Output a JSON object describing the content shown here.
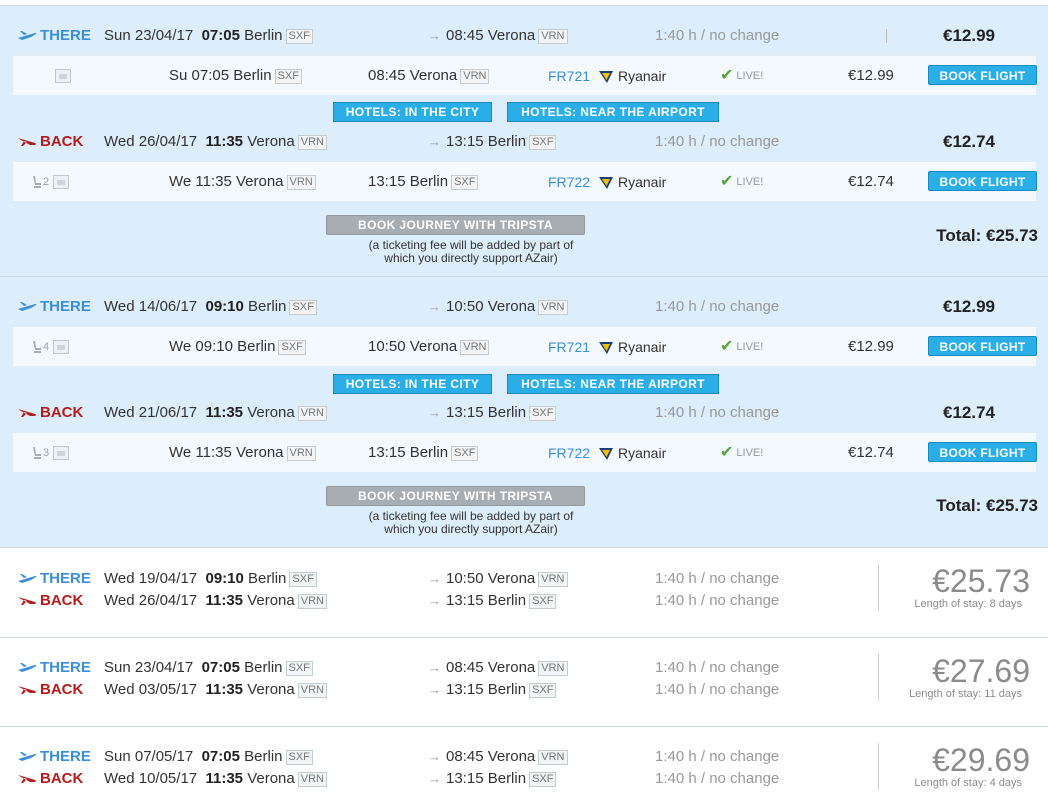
{
  "icons": {
    "there": "plane-takeoff-icon",
    "back": "plane-landing-icon",
    "seat": "seat-icon",
    "image": "image-placeholder-icon",
    "airline": "ryanair-harp-icon",
    "check": "check-icon",
    "arrow": "arrow-right-icon"
  },
  "colors": {
    "there": "#3b8fd9",
    "back": "#b71c1c",
    "button": "#29aee8",
    "expanded_bg": "#dcedfb",
    "live": "#58a53b"
  },
  "labels": {
    "there": "THERE",
    "back": "BACK",
    "book_flight": "BOOK FLIGHT",
    "hotels_city": "HOTELS: IN THE CITY",
    "hotels_airport": "HOTELS: NEAR THE AIRPORT",
    "book_journey": "BOOK JOURNEY WITH TRIPSTA",
    "fee_line1": "(a ticketing fee will be added by part of",
    "fee_line2": "which you directly support AZair)",
    "live": "LIVE!",
    "arrow": "→",
    "check": "✔"
  },
  "results": [
    {
      "there": {
        "date": "Sun 23/04/17",
        "dep_time": "07:05",
        "dep_city": "Berlin",
        "dep_code": "SXF",
        "arr_time": "08:45",
        "arr_city": "Verona",
        "arr_code": "VRN",
        "duration": "1:40 h / no change",
        "price": "€12.99"
      },
      "there_seg": {
        "seats": "",
        "dep": "Su 07:05 Berlin",
        "dep_code": "SXF",
        "arr": "08:45 Verona",
        "arr_code": "VRN",
        "flight": "FR721",
        "airline": "Ryanair",
        "price": "€12.99"
      },
      "back": {
        "date": "Wed 26/04/17",
        "dep_time": "11:35",
        "dep_city": "Verona",
        "dep_code": "VRN",
        "arr_time": "13:15",
        "arr_city": "Berlin",
        "arr_code": "SXF",
        "duration": "1:40 h / no change",
        "price": "€12.74"
      },
      "back_seg": {
        "seats": "2",
        "dep": "We 11:35 Verona",
        "dep_code": "VRN",
        "arr": "13:15 Berlin",
        "arr_code": "SXF",
        "flight": "FR722",
        "airline": "Ryanair",
        "price": "€12.74"
      },
      "total": "Total: €25.73"
    },
    {
      "there": {
        "date": "Wed 14/06/17",
        "dep_time": "09:10",
        "dep_city": "Berlin",
        "dep_code": "SXF",
        "arr_time": "10:50",
        "arr_city": "Verona",
        "arr_code": "VRN",
        "duration": "1:40 h / no change",
        "price": "€12.99"
      },
      "there_seg": {
        "seats": "4",
        "dep": "We 09:10 Berlin",
        "dep_code": "SXF",
        "arr": "10:50 Verona",
        "arr_code": "VRN",
        "flight": "FR721",
        "airline": "Ryanair",
        "price": "€12.99"
      },
      "back": {
        "date": "Wed 21/06/17",
        "dep_time": "11:35",
        "dep_city": "Verona",
        "dep_code": "VRN",
        "arr_time": "13:15",
        "arr_city": "Berlin",
        "arr_code": "SXF",
        "duration": "1:40 h / no change",
        "price": "€12.74"
      },
      "back_seg": {
        "seats": "3",
        "dep": "We 11:35 Verona",
        "dep_code": "VRN",
        "arr": "13:15 Berlin",
        "arr_code": "SXF",
        "flight": "FR722",
        "airline": "Ryanair",
        "price": "€12.74"
      },
      "total": "Total: €25.73"
    },
    {
      "there": {
        "date": "Wed 19/04/17",
        "dep_time": "09:10",
        "dep_city": "Berlin",
        "dep_code": "SXF",
        "arr_time": "10:50",
        "arr_city": "Verona",
        "arr_code": "VRN",
        "duration": "1:40 h / no change"
      },
      "back": {
        "date": "Wed 26/04/17",
        "dep_time": "11:35",
        "dep_city": "Verona",
        "dep_code": "VRN",
        "arr_time": "13:15",
        "arr_city": "Berlin",
        "arr_code": "SXF",
        "duration": "1:40 h / no change"
      },
      "price": "€25.73",
      "stay": "Length of stay: 8 days"
    },
    {
      "there": {
        "date": "Sun 23/04/17",
        "dep_time": "07:05",
        "dep_city": "Berlin",
        "dep_code": "SXF",
        "arr_time": "08:45",
        "arr_city": "Verona",
        "arr_code": "VRN",
        "duration": "1:40 h / no change"
      },
      "back": {
        "date": "Wed 03/05/17",
        "dep_time": "11:35",
        "dep_city": "Verona",
        "dep_code": "VRN",
        "arr_time": "13:15",
        "arr_city": "Berlin",
        "arr_code": "SXF",
        "duration": "1:40 h / no change"
      },
      "price": "€27.69",
      "stay": "Length of stay: 11 days"
    },
    {
      "there": {
        "date": "Sun 07/05/17",
        "dep_time": "07:05",
        "dep_city": "Berlin",
        "dep_code": "SXF",
        "arr_time": "08:45",
        "arr_city": "Verona",
        "arr_code": "VRN",
        "duration": "1:40 h / no change"
      },
      "back": {
        "date": "Wed 10/05/17",
        "dep_time": "11:35",
        "dep_city": "Verona",
        "dep_code": "VRN",
        "arr_time": "13:15",
        "arr_city": "Berlin",
        "arr_code": "SXF",
        "duration": "1:40 h / no change"
      },
      "price": "€29.69",
      "stay": "Length of stay: 4 days"
    }
  ]
}
